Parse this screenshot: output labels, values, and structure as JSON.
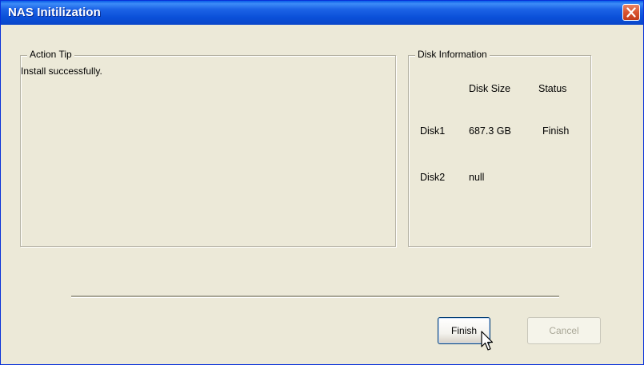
{
  "window": {
    "title": "NAS Initilization"
  },
  "action_tip": {
    "legend": "Action Tip",
    "message": "Install successfully."
  },
  "disk_info": {
    "legend": "Disk Information",
    "columns": [
      "",
      "Disk Size",
      "Status"
    ],
    "rows": [
      {
        "disk": "Disk1",
        "size": "687.3 GB",
        "status": "Finish"
      },
      {
        "disk": "Disk2",
        "size": "null",
        "status": ""
      }
    ]
  },
  "buttons": {
    "finish": "Finish",
    "cancel": "Cancel"
  },
  "icons": {
    "close": "close-icon",
    "cursor": "mouse-pointer-icon"
  },
  "colors": {
    "titlebar": "#0a4fd8",
    "window_face": "#ece9d8",
    "close_button": "#d9532f"
  }
}
